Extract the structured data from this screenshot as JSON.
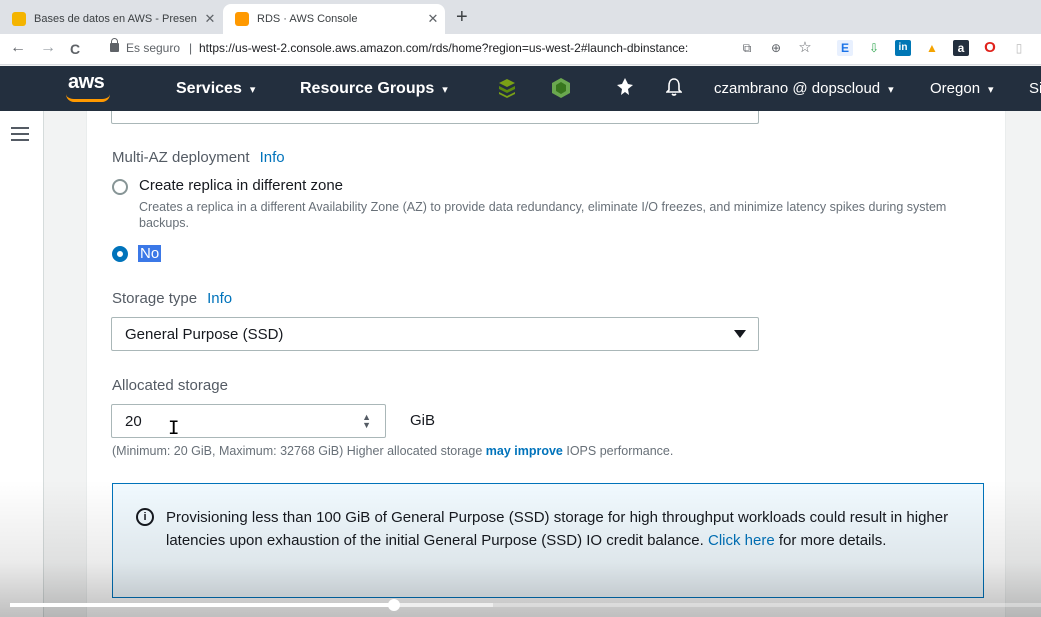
{
  "browser": {
    "tabs": [
      {
        "title": "Bases de datos en AWS - Presen",
        "favicon_color": "#f4b400"
      },
      {
        "title": "RDS · AWS Console",
        "favicon_color": "#ff9900"
      }
    ],
    "tab_close": "✕",
    "new_tab": "+",
    "back": "←",
    "forward": "→",
    "reload": "C",
    "secure_label": "Es seguro",
    "url": "https://us-west-2.console.aws.amazon.com/rds/home?region=us-west-2#launch-dbinstance:",
    "extension_icons": [
      "translate-icon",
      "zoom-icon",
      "star-icon",
      "extension-e-icon",
      "extension-download-icon",
      "linkedin-icon",
      "extension-triangle-icon",
      "amazon-assistant-icon",
      "opera-icon",
      "pdf-icon"
    ]
  },
  "aws_header": {
    "logo": "aws",
    "services": "Services",
    "resource_groups": "Resource Groups",
    "caret": "▾",
    "user": "czambrano @ dopscloud",
    "region": "Oregon",
    "support": "Si"
  },
  "form": {
    "multi_az": {
      "label": "Multi-AZ deployment",
      "info": "Info",
      "options": [
        {
          "label": "Create replica in different zone",
          "description": "Creates a replica in a different Availability Zone (AZ) to provide data redundancy, eliminate I/O freezes, and minimize latency spikes during system backups.",
          "selected": false
        },
        {
          "label": "No",
          "selected": true
        }
      ]
    },
    "storage_type": {
      "label": "Storage type",
      "info": "Info",
      "value": "General Purpose (SSD)"
    },
    "allocated_storage": {
      "label": "Allocated storage",
      "value": "20",
      "unit": "GiB",
      "hint_prefix": "(Minimum: 20 GiB, Maximum: 32768 GiB) Higher allocated storage ",
      "hint_link": "may improve",
      "hint_suffix": " IOPS performance."
    },
    "alert": {
      "text": "Provisioning less than 100 GiB of General Purpose (SSD) storage for high throughput workloads could result in higher latencies upon exhaustion of the initial General Purpose (SSD) IO credit balance. ",
      "link": "Click here",
      "suffix": " for more details."
    }
  },
  "video": {
    "played_fraction": 0.372,
    "buffered_fraction": 0.468
  }
}
